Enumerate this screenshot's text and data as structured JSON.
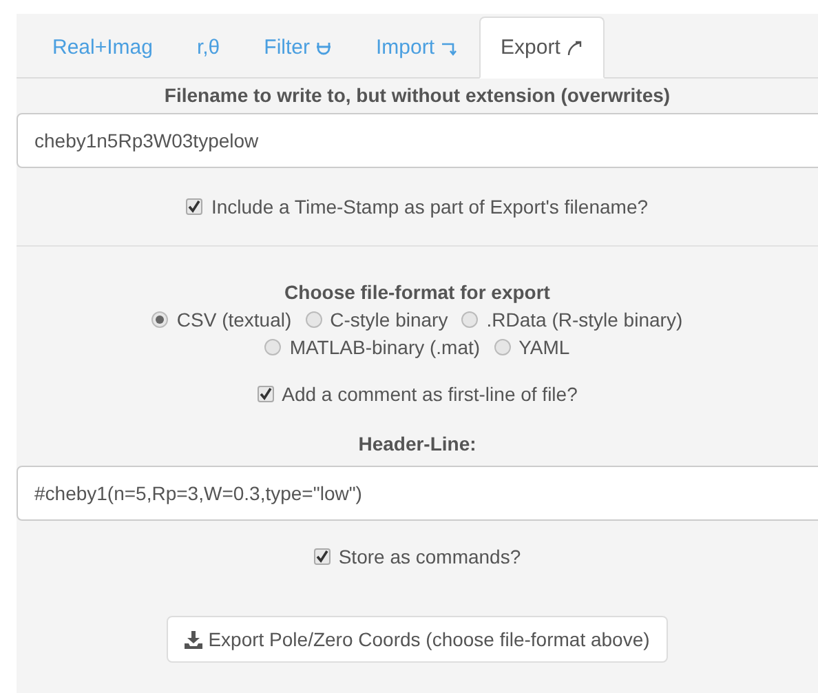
{
  "tabs": [
    {
      "label": "Real+Imag",
      "kind": "text",
      "selected": false
    },
    {
      "label": "r,θ",
      "kind": "text",
      "selected": false
    },
    {
      "label": "Filter",
      "kind": "filter",
      "selected": false
    },
    {
      "label": "Import",
      "kind": "import",
      "selected": false
    },
    {
      "label": "Export",
      "kind": "export",
      "selected": true
    }
  ],
  "filename": {
    "label": "Filename to write to, but without extension (overwrites)",
    "value": "cheby1n5Rp3W03typelow"
  },
  "timestamp": {
    "label": "Include a Time-Stamp as part of Export's filename?",
    "checked": true
  },
  "format": {
    "label": "Choose file-format for export",
    "options": [
      {
        "label": "CSV (textual)",
        "selected": true
      },
      {
        "label": "C-style binary",
        "selected": false
      },
      {
        "label": ".RData (R-style binary)",
        "selected": false
      },
      {
        "label": "MATLAB-binary (.mat)",
        "selected": false
      },
      {
        "label": "YAML",
        "selected": false
      }
    ]
  },
  "comment": {
    "label": "Add a comment as first-line of file?",
    "checked": true
  },
  "header_line": {
    "label": "Header-Line:",
    "value": "#cheby1(n=5,Rp=3,W=0.3,type=\"low\")"
  },
  "store_commands": {
    "label": "Store as commands?",
    "checked": true
  },
  "export_button": {
    "label": "Export Pole/Zero Coords (choose file-format above)"
  }
}
